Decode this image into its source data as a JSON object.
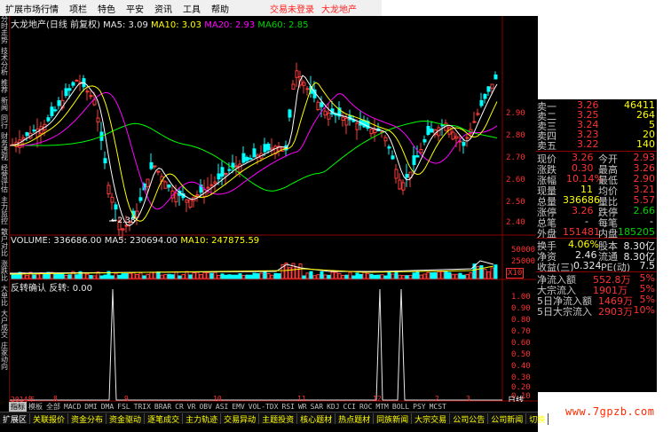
{
  "menu": [
    "扩展市场行情",
    "项栏",
    "特色",
    "平安",
    "资讯",
    "工具",
    "帮助"
  ],
  "status": {
    "login": "交易未登录",
    "stock": "大龙地产"
  },
  "left_tabs": [
    "分时走势",
    "技术分析",
    "推荐",
    "新闻",
    "同行",
    "财务透视",
    "经营评估",
    "主力监控",
    "散户对比",
    "涨跌比",
    "大单比",
    "大户成交",
    "庄家动向"
  ],
  "price_chart": {
    "title": "大龙地产(日线 前复权)",
    "ma5": "MA5: 3.09",
    "ma10": "MA10: 3.03",
    "ma20": "MA20: 2.93",
    "ma60": "MA60: 2.85",
    "low_marker": "2.38",
    "y_labels": [
      "2.90",
      "2.80",
      "2.70",
      "2.60",
      "2.50",
      "2.40"
    ],
    "colors": {
      "ma5": "#ffffff",
      "ma10": "#ffff00",
      "ma20": "#ff00ff",
      "ma60": "#00ff00"
    }
  },
  "volume_chart": {
    "title": "VOLUME: 336686.00",
    "ma5": "MA5: 230694.00",
    "ma10": "MA10: 247875.59",
    "y_labels": [
      "50000",
      "25000"
    ],
    "unit": "X10"
  },
  "indicator_chart": {
    "title": "反转确认",
    "value": "反转: 0.00",
    "y_labels": [
      "1.00",
      "0.90",
      "0.80",
      "0.70",
      "0.60",
      "0.50",
      "0.40",
      "0.30",
      "0.20",
      "0.10"
    ]
  },
  "date_axis": {
    "labels": [
      "2014年",
      "8",
      "9",
      "10",
      "11",
      "12",
      "2",
      "3"
    ],
    "period": "日线"
  },
  "quote": {
    "sell": [
      {
        "label": "卖一",
        "price": "3.26",
        "vol": "46411"
      },
      {
        "label": "卖二",
        "price": "3.25",
        "vol": "264"
      },
      {
        "label": "卖三",
        "price": "3.24",
        "vol": "5"
      },
      {
        "label": "卖四",
        "price": "3.23",
        "vol": "20"
      },
      {
        "label": "卖五",
        "price": "3.22",
        "vol": "140"
      }
    ],
    "rows": [
      [
        "现价",
        "3.26",
        "今开",
        "2.93"
      ],
      [
        "涨跌",
        "0.30",
        "最高",
        "3.26"
      ],
      [
        "涨幅",
        "10.14%",
        "最低",
        "2.90"
      ],
      [
        "现量",
        "11",
        "均价",
        "3.21"
      ],
      [
        "总量",
        "336686",
        "量比",
        "5.57"
      ],
      [
        "涨停",
        "3.26",
        "跌停",
        "2.66"
      ],
      [
        "总笔",
        "-",
        "每笔",
        "-"
      ],
      [
        "外盘",
        "151481",
        "内盘",
        "185205"
      ],
      [
        "换手",
        "4.06%",
        "股本",
        "8.30亿"
      ],
      [
        "净资",
        "2.46",
        "流通",
        "8.30亿"
      ],
      [
        "收益(三)",
        "0.324",
        "PE(动)",
        "7.5"
      ],
      [
        "净流入额",
        "552.8万",
        "",
        "5%"
      ],
      [
        "大宗流入",
        "1901万",
        "",
        "5%"
      ],
      [
        "5日净流入额",
        "1469万",
        "",
        "5%"
      ],
      [
        "5日大宗流入",
        "2903万",
        "",
        "10%"
      ]
    ]
  },
  "indicators": [
    "指标",
    "模板",
    "全部",
    "MACD",
    "DMI",
    "DMA",
    "FSL",
    "TRIX",
    "BRAR",
    "CR",
    "VR",
    "OBV",
    "ASI",
    "EMV",
    "VOL-TDX",
    "RSI",
    "WR",
    "SAR",
    "KDJ",
    "CCI",
    "ROC",
    "MTM",
    "BOLL",
    "PSY",
    "MCST"
  ],
  "bottom_tabs": [
    "扩展区",
    "关联报价",
    "资金分布",
    "资金驱动",
    "逐笔成交",
    "主力轨迹",
    "交易异动",
    "主题投资",
    "核心题材",
    "热点题材",
    "同族新闻",
    "大宗交易",
    "公司公告",
    "公司新闻",
    "切换"
  ],
  "watermark": "www.7gpzb.com"
}
